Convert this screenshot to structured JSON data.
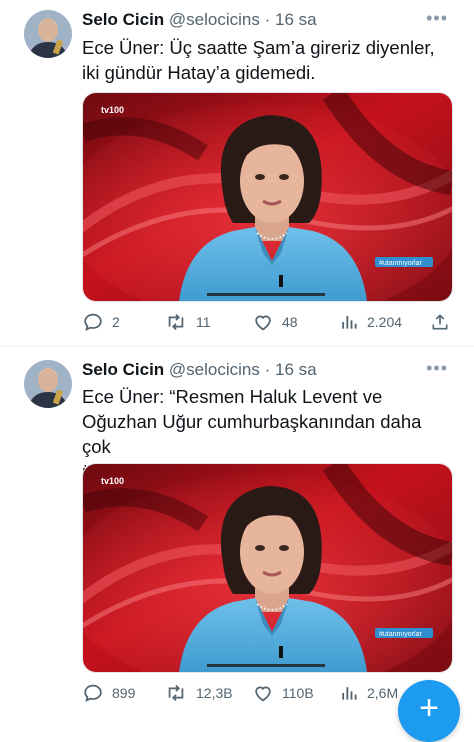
{
  "tweets": [
    {
      "author": "Selo Cicin",
      "handle": "@selocicins",
      "time": "16 sa",
      "separator": "·",
      "text_lines": [
        "Ece Üner: Üç saatte Şam’a gireriz diyenler,",
        "iki gündür Hatay’a gidemedi."
      ],
      "channel_logo": "tv100",
      "overlay_tag": "#utanmıyorlar",
      "replies": "2",
      "retweets": "11",
      "likes": "48",
      "views": "2.204"
    },
    {
      "author": "Selo Cicin",
      "handle": "@selocicins",
      "time": "16 sa",
      "separator": "·",
      "text_lines": [
        "Ece Üner: “Resmen Haluk Levent ve",
        "Oğuzhan Uğur cumhurbaşkanından daha çok",
        "ülkeyle ilgileniyor…”"
      ],
      "channel_logo": "tv100",
      "overlay_tag": "#utanmıyorlar",
      "replies": "899",
      "retweets": "12,3B",
      "likes": "110B",
      "views": "2,6M"
    }
  ],
  "more_icon": "more-horizontal-icon",
  "compose_icon": "plus-icon",
  "colors": {
    "accent": "#1d9bf0",
    "text": "#0f1419",
    "muted": "#536471",
    "tv_red": "#c8101c",
    "blazer": "#5ab3e0"
  }
}
